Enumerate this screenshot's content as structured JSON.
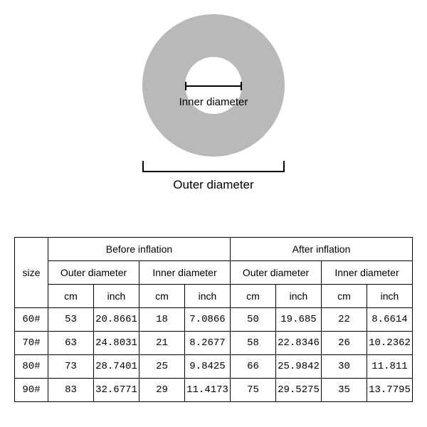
{
  "diagram": {
    "inner_label": "Inner diameter",
    "outer_label": "Outer diameter"
  },
  "table": {
    "size_header": "size",
    "group_before": "Before inflation",
    "group_after": "After inflation",
    "sub_outer": "Outer diameter",
    "sub_inner": "Inner diameter",
    "unit_cm": "cm",
    "unit_inch": "inch",
    "rows": [
      {
        "size": "60#",
        "b_out_cm": "53",
        "b_out_in": "20.8661",
        "b_in_cm": "18",
        "b_in_in": "7.0866",
        "a_out_cm": "50",
        "a_out_in": "19.685",
        "a_in_cm": "22",
        "a_in_in": "8.6614"
      },
      {
        "size": "70#",
        "b_out_cm": "63",
        "b_out_in": "24.8031",
        "b_in_cm": "21",
        "b_in_in": "8.2677",
        "a_out_cm": "58",
        "a_out_in": "22.8346",
        "a_in_cm": "26",
        "a_in_in": "10.2362"
      },
      {
        "size": "80#",
        "b_out_cm": "73",
        "b_out_in": "28.7401",
        "b_in_cm": "25",
        "b_in_in": "9.8425",
        "a_out_cm": "66",
        "a_out_in": "25.9842",
        "a_in_cm": "30",
        "a_in_in": "11.811"
      },
      {
        "size": "90#",
        "b_out_cm": "83",
        "b_out_in": "32.6771",
        "b_in_cm": "29",
        "b_in_in": "11.4173",
        "a_out_cm": "75",
        "a_out_in": "29.5275",
        "a_in_cm": "35",
        "a_in_in": "13.7795"
      }
    ]
  }
}
